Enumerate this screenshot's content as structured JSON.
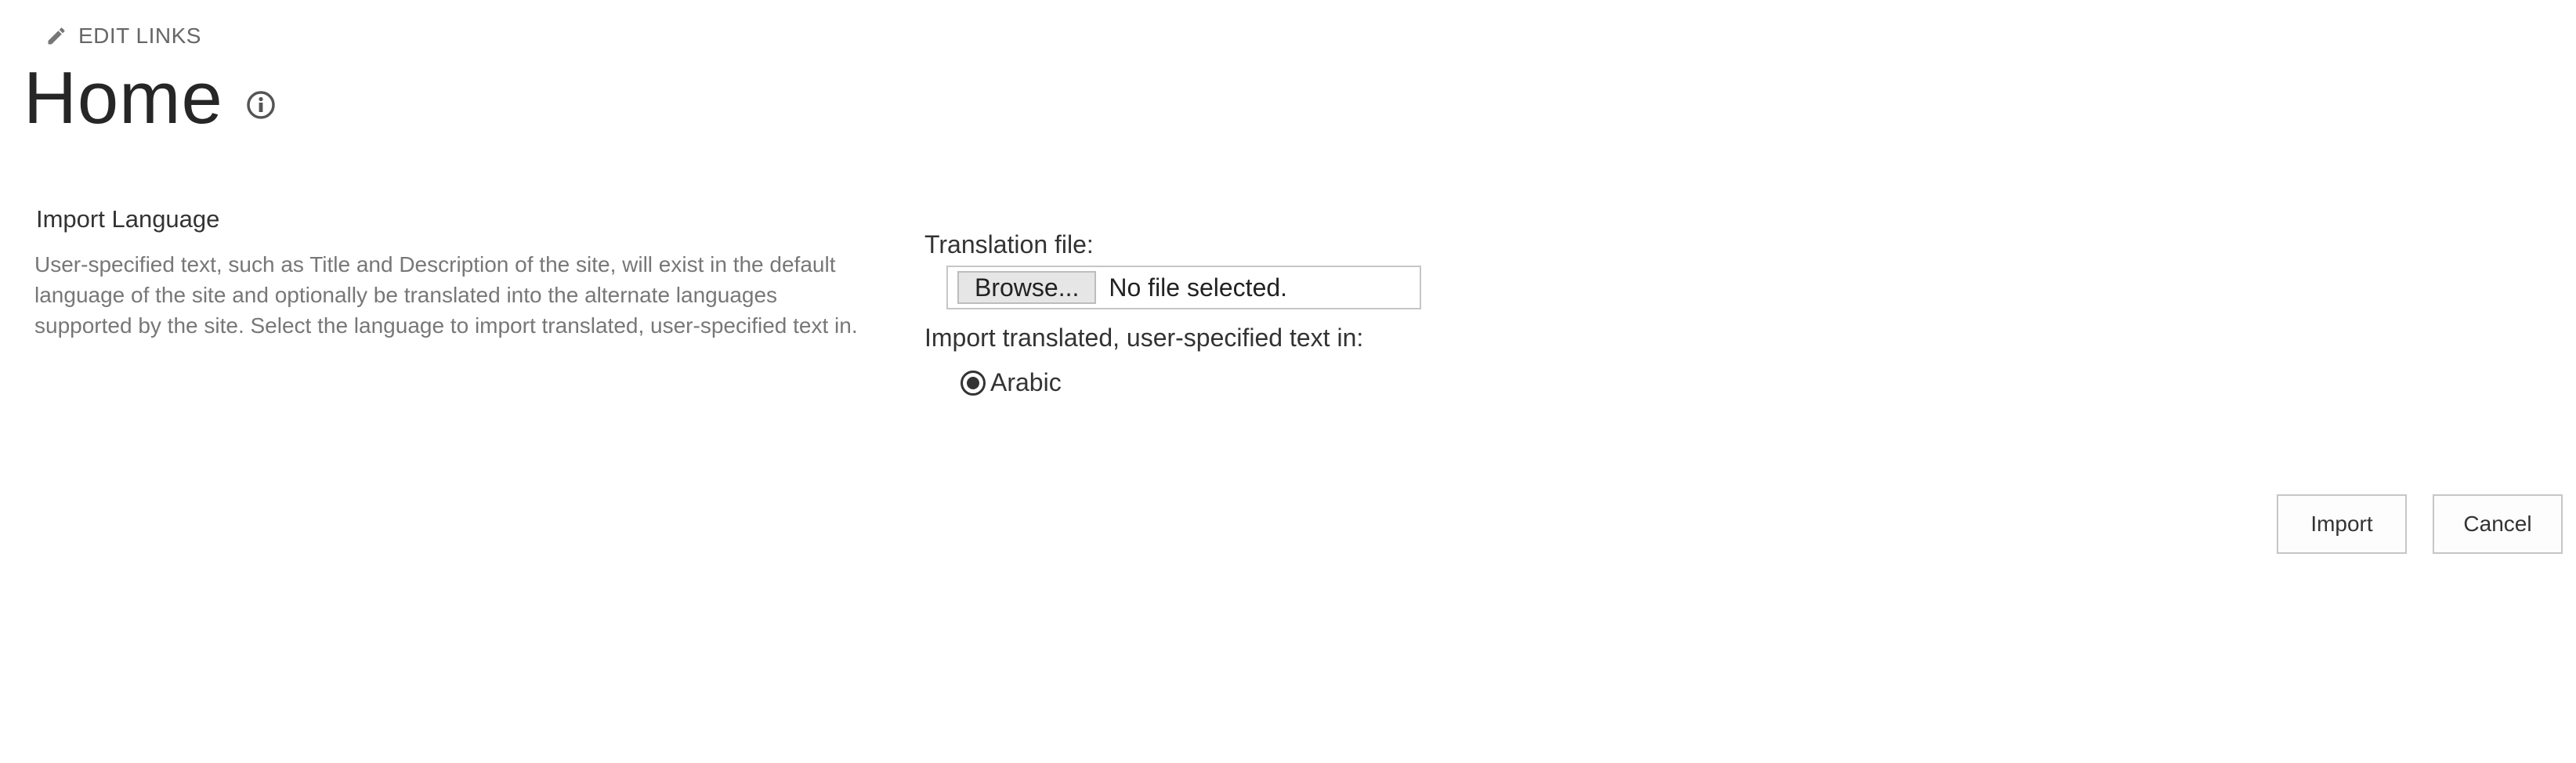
{
  "header": {
    "edit_links_label": "EDIT LINKS",
    "edit_icon": "pencil-icon",
    "title": "Home",
    "info_icon": "info-icon"
  },
  "section": {
    "title": "Import Language",
    "description": "User-specified text, such as Title and Description of the site, will exist in the default language of the site and optionally be translated into the alternate languages supported by the site. Select the language to import translated, user-specified text in."
  },
  "form": {
    "translation_file_label": "Translation file:",
    "browse_label": "Browse...",
    "file_status": "No file selected.",
    "import_in_label": "Import translated, user-specified text in:",
    "languages": [
      {
        "label": "Arabic",
        "selected": true
      }
    ]
  },
  "actions": {
    "import_label": "Import",
    "cancel_label": "Cancel"
  },
  "colors": {
    "text": "#333333",
    "muted": "#777777",
    "border": "#c6c6c6"
  }
}
